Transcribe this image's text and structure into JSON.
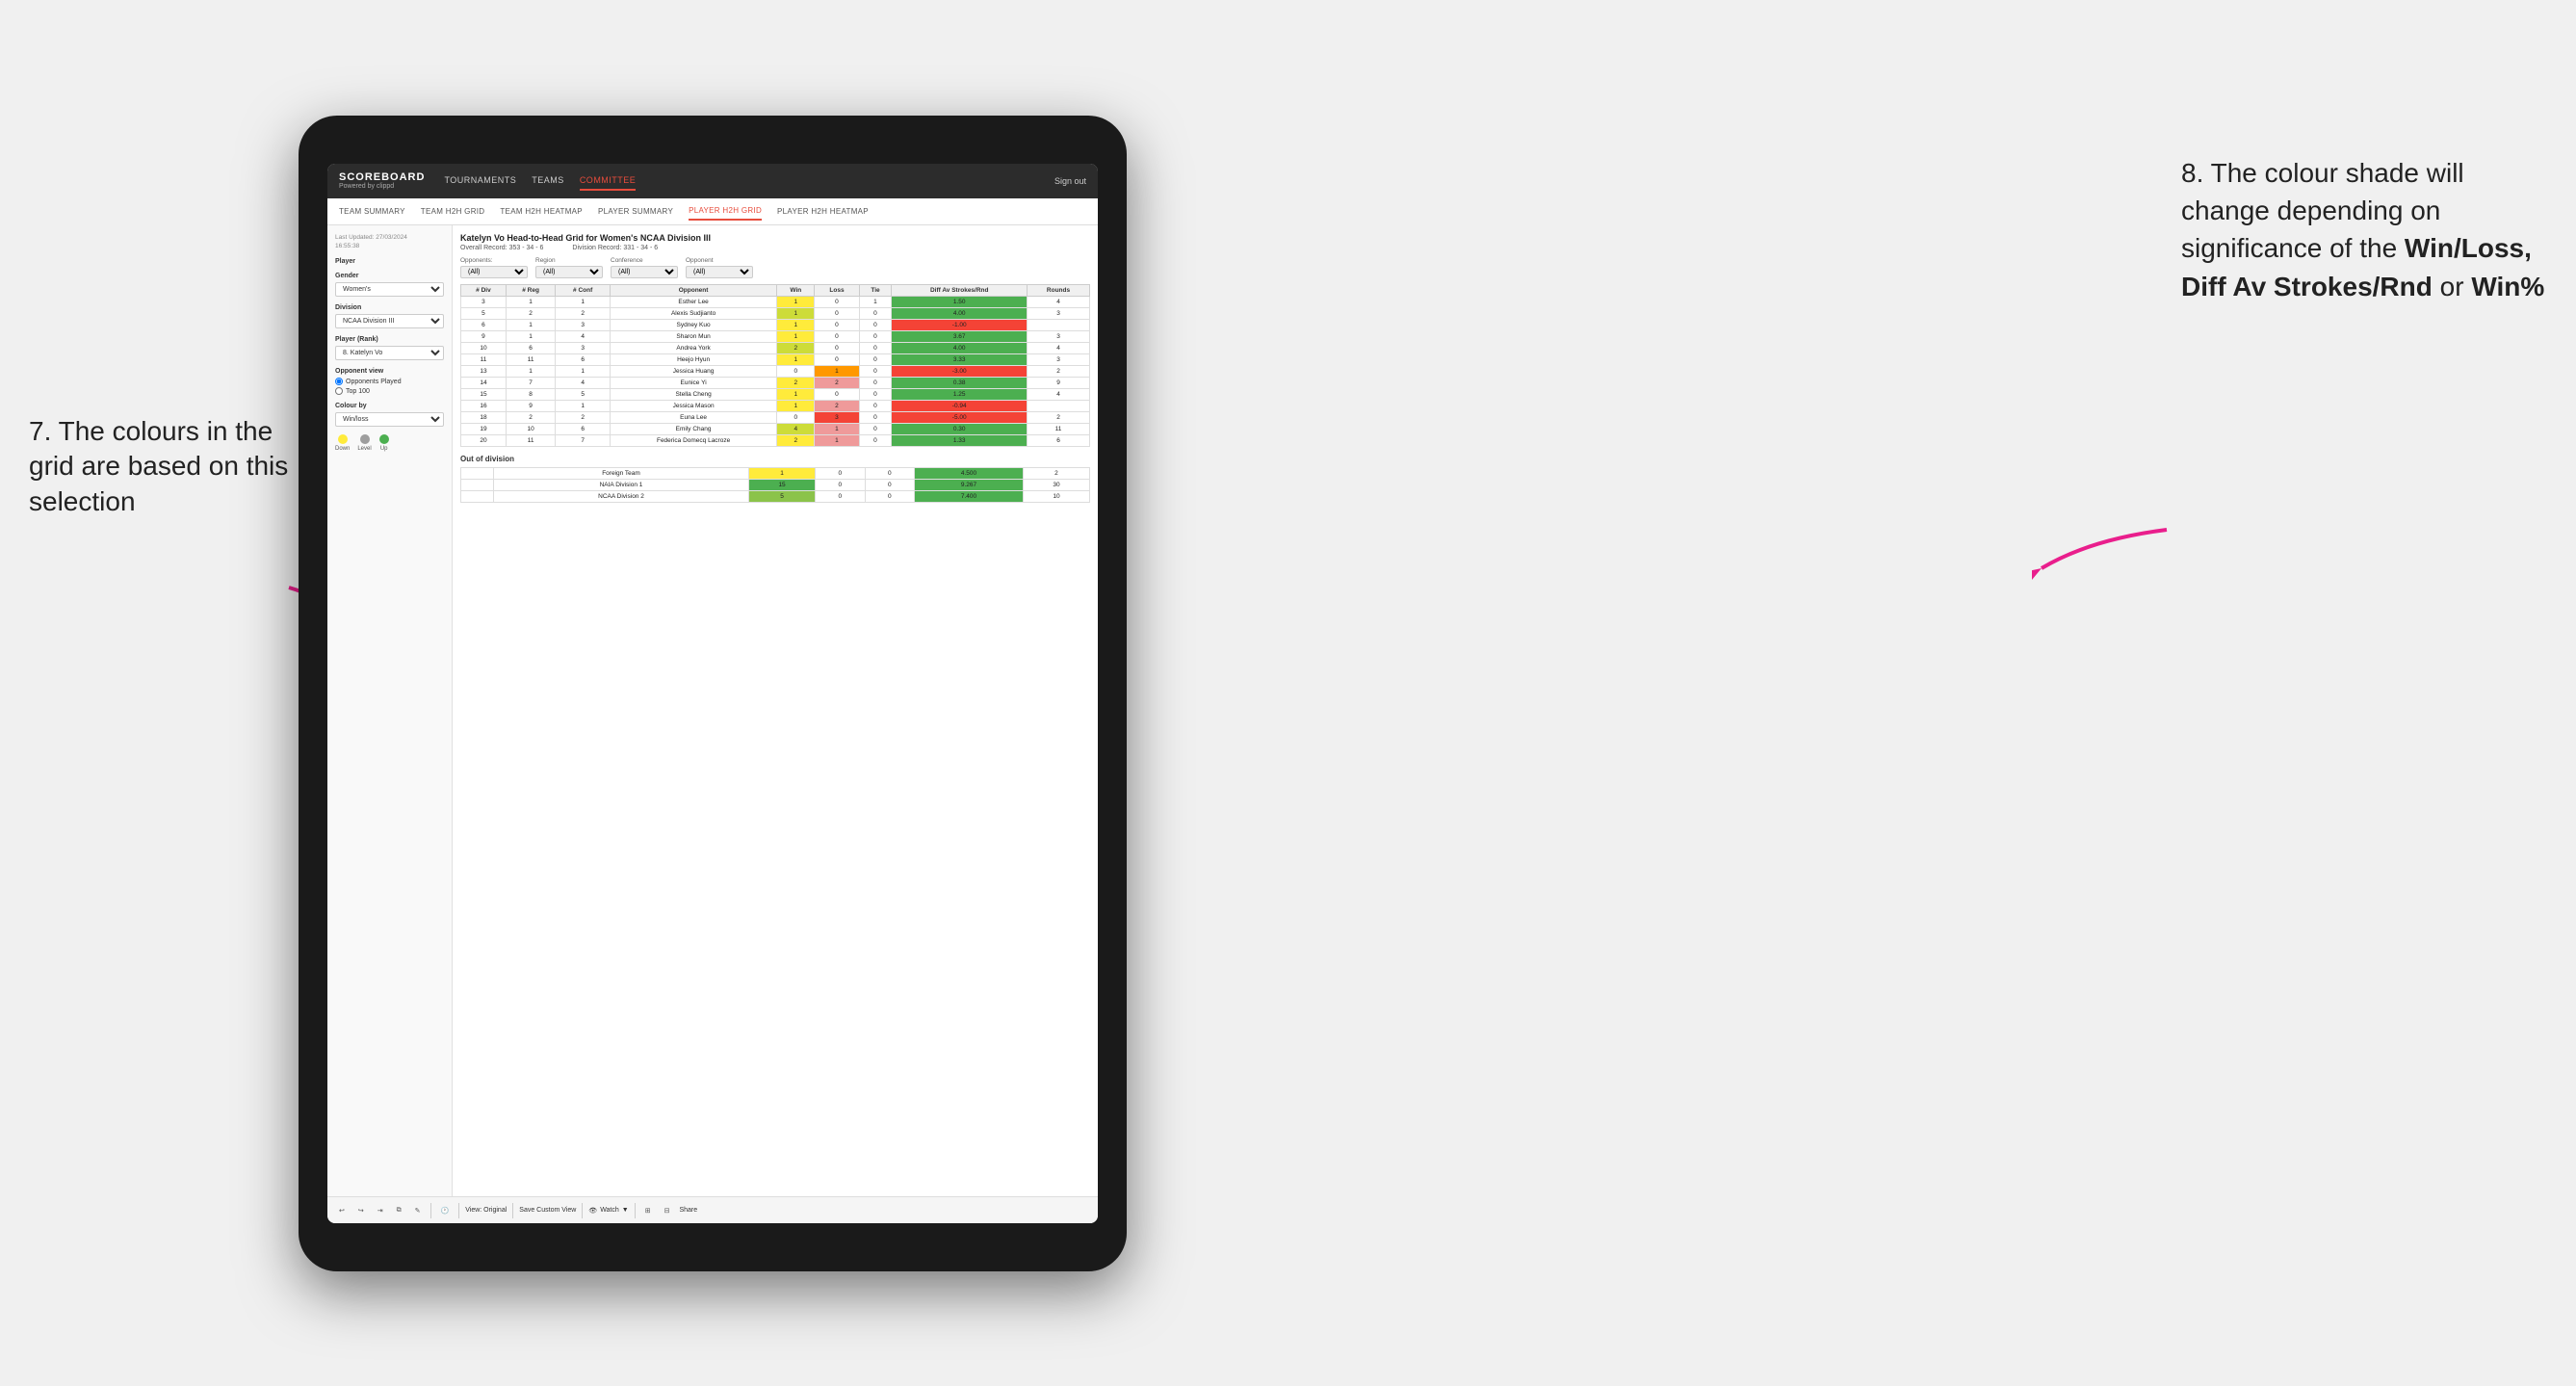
{
  "app": {
    "logo": "SCOREBOARD",
    "logo_sub": "Powered by clippd",
    "nav": {
      "links": [
        "TOURNAMENTS",
        "TEAMS",
        "COMMITTEE"
      ],
      "active": "COMMITTEE",
      "sign_in": "Sign out"
    },
    "sub_nav": {
      "links": [
        "TEAM SUMMARY",
        "TEAM H2H GRID",
        "TEAM H2H HEATMAP",
        "PLAYER SUMMARY",
        "PLAYER H2H GRID",
        "PLAYER H2H HEATMAP"
      ],
      "active": "PLAYER H2H GRID"
    }
  },
  "sidebar": {
    "timestamp_label": "Last Updated: 27/03/2024",
    "timestamp_time": "16:55:38",
    "player_label": "Player",
    "gender_label": "Gender",
    "gender_value": "Women's",
    "division_label": "Division",
    "division_value": "NCAA Division III",
    "player_rank_label": "Player (Rank)",
    "player_rank_value": "8. Katelyn Vo",
    "opponent_view_label": "Opponent view",
    "opponent_played": "Opponents Played",
    "top100": "Top 100",
    "colour_by_label": "Colour by",
    "colour_by_value": "Win/loss",
    "colour_legend": {
      "down": "Down",
      "level": "Level",
      "up": "Up"
    }
  },
  "grid": {
    "title": "Katelyn Vo Head-to-Head Grid for Women's NCAA Division III",
    "overall_record_label": "Overall Record:",
    "overall_record": "353 - 34 - 6",
    "division_record_label": "Division Record:",
    "division_record": "331 - 34 - 6",
    "filters": {
      "opponents_label": "Opponents:",
      "opponents_value": "(All)",
      "region_label": "Region",
      "region_value": "(All)",
      "conference_label": "Conference",
      "conference_value": "(All)",
      "opponent_label": "Opponent",
      "opponent_value": "(All)"
    },
    "table_headers": [
      "# Div",
      "# Reg",
      "# Conf",
      "Opponent",
      "Win",
      "Loss",
      "Tie",
      "Diff Av Strokes/Rnd",
      "Rounds"
    ],
    "rows": [
      {
        "div": 3,
        "reg": 1,
        "conf": 1,
        "name": "Esther Lee",
        "win": 1,
        "loss": 0,
        "tie": 1,
        "diff": "1.50",
        "rounds": 4,
        "win_class": "win-yellow",
        "loss_class": "",
        "diff_class": "diff-positive"
      },
      {
        "div": 5,
        "reg": 2,
        "conf": 2,
        "name": "Alexis Sudjianto",
        "win": 1,
        "loss": 0,
        "tie": 0,
        "diff": "4.00",
        "rounds": 3,
        "win_class": "win-green-light",
        "loss_class": "",
        "diff_class": "diff-positive"
      },
      {
        "div": 6,
        "reg": 1,
        "conf": 3,
        "name": "Sydney Kuo",
        "win": 1,
        "loss": 0,
        "tie": 0,
        "diff": "-1.00",
        "rounds": "",
        "win_class": "win-yellow",
        "loss_class": "",
        "diff_class": "diff-negative"
      },
      {
        "div": 9,
        "reg": 1,
        "conf": 4,
        "name": "Sharon Mun",
        "win": 1,
        "loss": 0,
        "tie": 0,
        "diff": "3.67",
        "rounds": 3,
        "win_class": "win-yellow",
        "loss_class": "",
        "diff_class": "diff-positive"
      },
      {
        "div": 10,
        "reg": 6,
        "conf": 3,
        "name": "Andrea York",
        "win": 2,
        "loss": 0,
        "tie": 0,
        "diff": "4.00",
        "rounds": 4,
        "win_class": "win-green-light",
        "loss_class": "",
        "diff_class": "diff-positive"
      },
      {
        "div": 11,
        "reg": 11,
        "conf": 6,
        "name": "Heejo Hyun",
        "win": 1,
        "loss": 0,
        "tie": 0,
        "diff": "3.33",
        "rounds": 3,
        "win_class": "win-yellow",
        "loss_class": "",
        "diff_class": "diff-positive"
      },
      {
        "div": 13,
        "reg": 1,
        "conf": 1,
        "name": "Jessica Huang",
        "win": 0,
        "loss": 1,
        "tie": 0,
        "diff": "-3.00",
        "rounds": 2,
        "win_class": "",
        "loss_class": "loss-orange",
        "diff_class": "diff-negative"
      },
      {
        "div": 14,
        "reg": 7,
        "conf": 4,
        "name": "Eunice Yi",
        "win": 2,
        "loss": 2,
        "tie": 0,
        "diff": "0.38",
        "rounds": 9,
        "win_class": "win-yellow",
        "loss_class": "loss-red-med",
        "diff_class": "diff-positive"
      },
      {
        "div": 15,
        "reg": 8,
        "conf": 5,
        "name": "Stella Cheng",
        "win": 1,
        "loss": 0,
        "tie": 0,
        "diff": "1.25",
        "rounds": 4,
        "win_class": "win-yellow",
        "loss_class": "",
        "diff_class": "diff-positive"
      },
      {
        "div": 16,
        "reg": 9,
        "conf": 1,
        "name": "Jessica Mason",
        "win": 1,
        "loss": 2,
        "tie": 0,
        "diff": "-0.94",
        "rounds": "",
        "win_class": "win-yellow",
        "loss_class": "loss-red-med",
        "diff_class": "diff-negative"
      },
      {
        "div": 18,
        "reg": 2,
        "conf": 2,
        "name": "Euna Lee",
        "win": 0,
        "loss": 3,
        "tie": 0,
        "diff": "-5.00",
        "rounds": 2,
        "win_class": "",
        "loss_class": "loss-red-dark",
        "diff_class": "diff-negative"
      },
      {
        "div": 19,
        "reg": 10,
        "conf": 6,
        "name": "Emily Chang",
        "win": 4,
        "loss": 1,
        "tie": 0,
        "diff": "0.30",
        "rounds": 11,
        "win_class": "win-green-light",
        "loss_class": "loss-red-med",
        "diff_class": "diff-positive"
      },
      {
        "div": 20,
        "reg": 11,
        "conf": 7,
        "name": "Federica Domecq Lacroze",
        "win": 2,
        "loss": 1,
        "tie": 0,
        "diff": "1.33",
        "rounds": 6,
        "win_class": "win-yellow",
        "loss_class": "loss-red-med",
        "diff_class": "diff-positive"
      }
    ],
    "out_of_division_label": "Out of division",
    "out_of_division_rows": [
      {
        "name": "Foreign Team",
        "win": 1,
        "loss": 0,
        "tie": 0,
        "diff": "4.500",
        "rounds": 2,
        "win_class": "win-yellow",
        "diff_class": "diff-positive"
      },
      {
        "name": "NAIA Division 1",
        "win": 15,
        "loss": 0,
        "tie": 0,
        "diff": "9.267",
        "rounds": 30,
        "win_class": "win-green-dark",
        "diff_class": "diff-positive"
      },
      {
        "name": "NCAA Division 2",
        "win": 5,
        "loss": 0,
        "tie": 0,
        "diff": "7.400",
        "rounds": 10,
        "win_class": "win-green-med",
        "diff_class": "diff-positive"
      }
    ]
  },
  "toolbar": {
    "view_original": "View: Original",
    "save_custom": "Save Custom View",
    "watch": "Watch",
    "share": "Share"
  },
  "annotations": {
    "left": "7. The colours in the grid are based on this selection",
    "right_pre": "8. The colour shade will change depending on significance of the ",
    "right_bold": "Win/Loss, Diff Av Strokes/Rnd",
    "right_post": " or ",
    "right_bold2": "Win%"
  },
  "arrow_left": "→",
  "arrow_right": "→"
}
